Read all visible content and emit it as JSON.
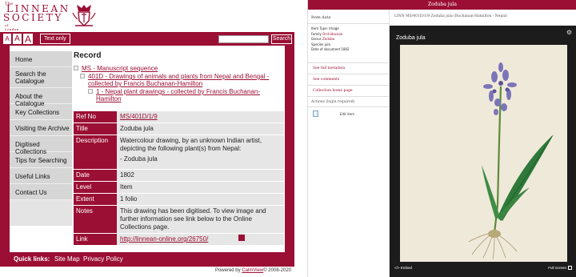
{
  "left": {
    "logo": {
      "the": "The",
      "line1": "LINNEAN",
      "line2": "SOCIETY",
      "line3": "of London"
    },
    "font_sizes": [
      "A",
      "A",
      "A"
    ],
    "text_only": "Text only",
    "search": {
      "value": "",
      "button": "Search"
    },
    "nav": [
      "Home",
      "Search the Catalogue",
      "About the Catalogue",
      "Key Collections",
      "Visiting the Archive",
      "Digitised Collections",
      "Tips for Searching",
      "Useful Links",
      "Contact Us"
    ],
    "record_title": "Record",
    "tree": [
      "MS - Manuscript sequence",
      "401D - Drawings of animals and plants from Nepal and Bengal - collected by Francis Buchanan-Hamilton",
      "1 - Nepal plant drawings - collected by Francis Buchanan-Hamilton"
    ],
    "record": {
      "ref_no": {
        "label": "Ref No",
        "value": "MS/401D/1/9"
      },
      "title": {
        "label": "Title",
        "value": "Zoduba jula"
      },
      "description": {
        "label": "Description",
        "value": "Watercolour drawing, by an unknown Indian artist, depicting the following plant(s) from Nepal:",
        "value2": "- Zoduba jula"
      },
      "date": {
        "label": "Date",
        "value": "1802"
      },
      "level": {
        "label": "Level",
        "value": "Item"
      },
      "extent": {
        "label": "Extent",
        "value": "1 folio"
      },
      "notes": {
        "label": "Notes",
        "value": "This drawing has been digitised. To view image and further information see link below to the Online Collections page."
      },
      "link": {
        "label": "Link",
        "value": "http://linnean-online.org/26750/"
      }
    },
    "footer": {
      "quick_links": "Quick links:",
      "site_map": "Site Map",
      "privacy": "Privacy Policy"
    },
    "powered": {
      "prefix": "Powered by",
      "brand": "CalmView",
      "suffix": "© 2008-2020"
    }
  },
  "right": {
    "top_title": "Zoduba jula",
    "item_data": "Item data",
    "breadcrumb": "LINN MS/401D/1/9 Zoduba jula (Buchanan-Hamilton - Nepal)",
    "meta": [
      {
        "k": "Item Type:",
        "v": "Image",
        "link": false
      },
      {
        "k": "Family",
        "v": "Orchidaceae",
        "link": true
      },
      {
        "k": "Genus",
        "v": "Zoduba",
        "link": true
      },
      {
        "k": "Species",
        "v": "jula",
        "link": false
      },
      {
        "k": "Date of document",
        "v": "1802",
        "link": false
      }
    ],
    "actions": [
      "See full metadata",
      "See comments",
      "Collection home page",
      "Actions (login required)"
    ],
    "edit_item": "Edit item",
    "viewer": {
      "title": "Zoduba jula",
      "embed": "Embed",
      "full_screen": "Full Screen"
    }
  },
  "colors": {
    "brand": "#9b0f34",
    "nav_bg": "#d6d6d6",
    "viewer_bg": "#1c1c1c"
  },
  "icons": [
    "crest-icon",
    "tree-node-icon",
    "gear-icon",
    "embed-icon",
    "fullscreen-icon",
    "edit-item-icon"
  ]
}
